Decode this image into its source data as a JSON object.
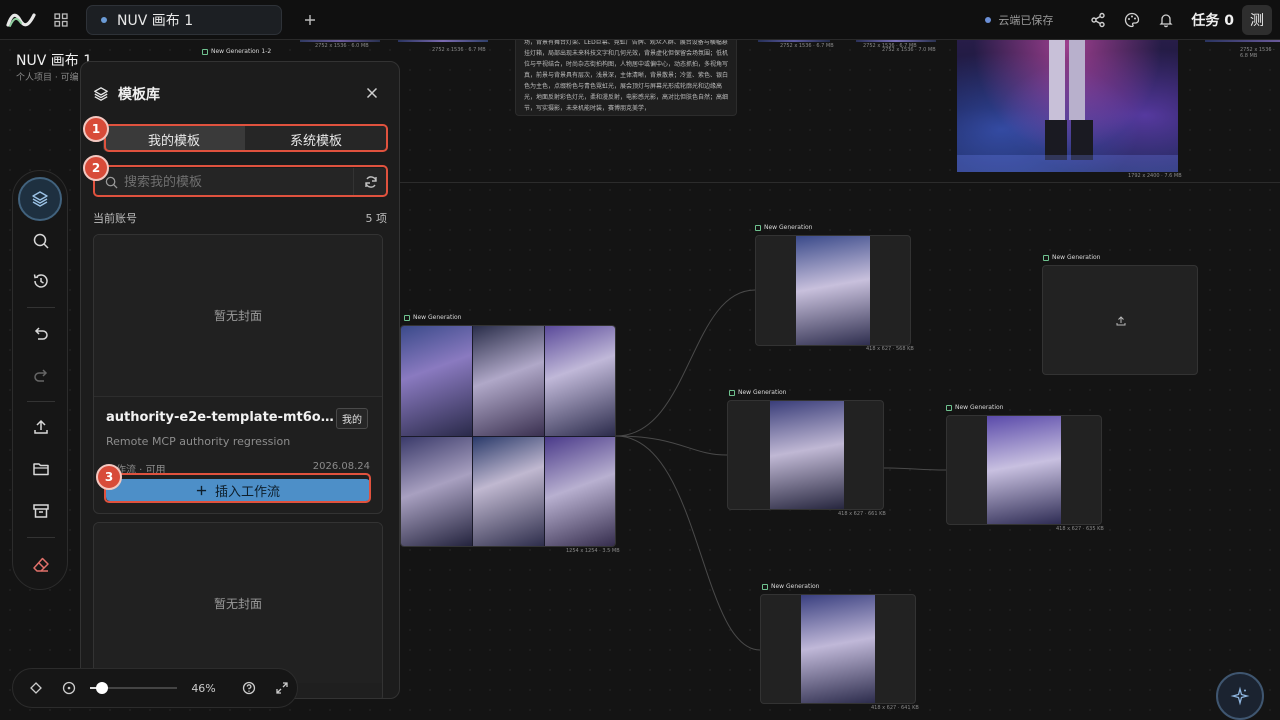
{
  "topbar": {
    "tab_title": "NUV 画布 1",
    "save_status": "云端已保存",
    "tasks_label": "任务 0",
    "user_initial": "测"
  },
  "project": {
    "title": "NUV 画布 1",
    "subtitle": "个人项目 · 可编"
  },
  "panel": {
    "title": "模板库",
    "tabs": [
      {
        "label": "我的模板",
        "active": true
      },
      {
        "label": "系统模板",
        "active": false
      }
    ],
    "search_placeholder": "搜索我的模板",
    "account_label": "当前账号",
    "count_label": "5 项",
    "cards": [
      {
        "cover_text": "暂无封面",
        "title": "authority-e2e-template-mt6o...",
        "badge": "我的",
        "description": "Remote MCP authority regression",
        "meta": "工作流 · 可用",
        "date": "2026.08.24",
        "insert_label": "插入工作流"
      },
      {
        "cover_text": "暂无封面"
      }
    ]
  },
  "annotations": [
    "1",
    "2",
    "3"
  ],
  "zoom": {
    "label": "46%",
    "level": 0.13
  },
  "canvas": {
    "top_labels": {
      "gen12": "New Generation 1-2",
      "m1": "2752 x 1536 · 6.0 MB",
      "m2": "2752 x 1536 · 6.7 MB",
      "m3": "2752 x 1536 · 6.7 MB",
      "m4": "2752 x 1536 · 7.0 MB",
      "m5": "1792 x 2400 · 7.6 MB",
      "m6": "2752 x 1536 · 6.8 MB"
    },
    "prompt_text": "场，背景有舞台灯架、LED巨幕、霓虹广告牌、观众人群、展台设备与横幅悬挂灯箱，局部出现未来科技文字和几何光效，背景虚化但保留会场氛围；低机位与平视结合，时尚杂志街拍构图，人物居中或偏中心，动态抓拍，多视角写真，前景与背景具有层次，浅景深，主体清晰，背景散景；冷蓝、紫色、银白色为主色，点缀粉色与青色霓虹光，展会顶灯与屏幕光形成轮廓光和边缘高光，地面反射彩色灯光，柔和漫反射，电影感光影，高对比但肤色自然；高细节，写实摄影，未来机能时装，赛博朋克美学，",
    "nodes": [
      {
        "label": "New Generation",
        "meta": "1254 x 1254 · 3.5 MB"
      },
      {
        "label": "New Generation",
        "meta": "418 x 627 · 568 KB"
      },
      {
        "label": "New Generation",
        "meta": ""
      },
      {
        "label": "New Generation",
        "meta": "418 x 627 · 661 KB"
      },
      {
        "label": "New Generation",
        "meta": "418 x 627 · 635 KB"
      },
      {
        "label": "New Generation",
        "meta": "418 x 627 · 641 KB"
      }
    ]
  }
}
